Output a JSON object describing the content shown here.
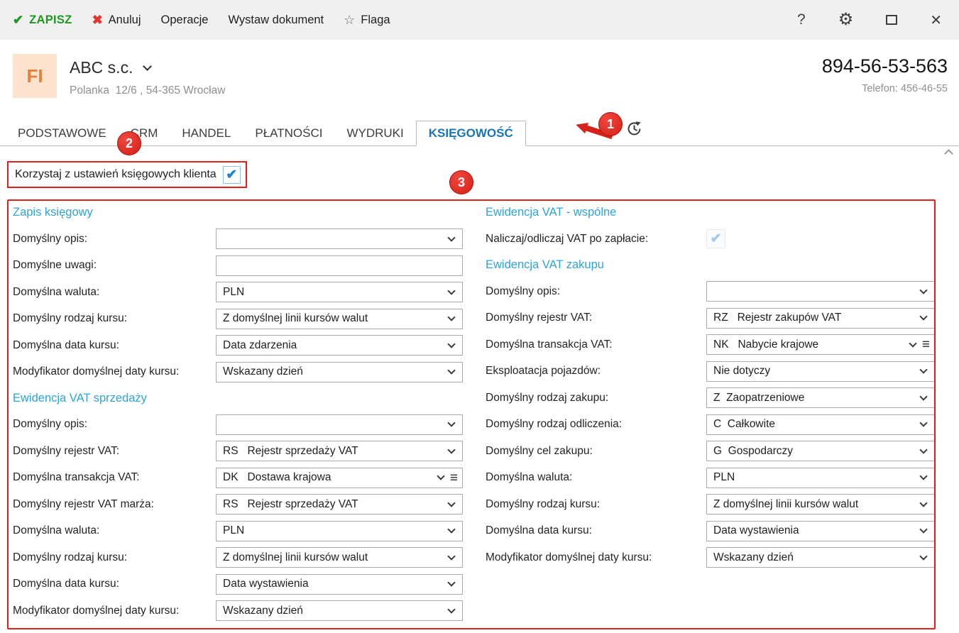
{
  "toolbar": {
    "save": "ZAPISZ",
    "cancel": "Anuluj",
    "operations": "Operacje",
    "issue_document": "Wystaw dokument",
    "flag": "Flaga",
    "help": "?"
  },
  "header": {
    "avatar_initials": "FI",
    "company_name": "ABC s.c.",
    "address": "Polanka  12/6 , 54-365 Wrocław",
    "tax_id": "894-56-53-563",
    "phone": "Telefon: 456-46-55"
  },
  "tabs": [
    {
      "label": "PODSTAWOWE",
      "active": false
    },
    {
      "label": "CRM",
      "active": false
    },
    {
      "label": "HANDEL",
      "active": false
    },
    {
      "label": "PŁATNOŚCI",
      "active": false
    },
    {
      "label": "WYDRUKI",
      "active": false
    },
    {
      "label": "KSIĘGOWOŚĆ",
      "active": true
    }
  ],
  "annotations": {
    "step1": "1",
    "step2": "2",
    "step3": "3",
    "accent_red": "#dd201d"
  },
  "settings_checkbox": {
    "label": "Korzystaj z ustawień księgowych klienta",
    "checked": true
  },
  "form": {
    "left_sections": [
      {
        "title": "Zapis księgowy",
        "fields": [
          {
            "label": "Domyślny opis:",
            "value": "",
            "type": "select"
          },
          {
            "label": "Domyślne uwagi:",
            "value": "",
            "type": "text"
          },
          {
            "label": "Domyślna waluta:",
            "value": "PLN",
            "type": "select"
          },
          {
            "label": "Domyślny rodzaj kursu:",
            "value": "Z domyślnej linii kursów walut",
            "type": "select"
          },
          {
            "label": "Domyślna data kursu:",
            "value": "Data zdarzenia",
            "type": "select"
          },
          {
            "label": "Modyfikator domyślnej daty kursu:",
            "value": "Wskazany dzień",
            "type": "select"
          }
        ]
      },
      {
        "title": "Ewidencja VAT sprzedaży",
        "fields": [
          {
            "label": "Domyślny opis:",
            "value": "",
            "type": "select"
          },
          {
            "label": "Domyślny rejestr VAT:",
            "value": "RS   Rejestr sprzedaży VAT",
            "type": "select"
          },
          {
            "label": "Domyślna transakcja VAT:",
            "value": "DK   Dostawa krajowa",
            "type": "select-menu"
          },
          {
            "label": "Domyślny rejestr VAT marża:",
            "value": "RS   Rejestr sprzedaży VAT",
            "type": "select"
          },
          {
            "label": "Domyślna waluta:",
            "value": "PLN",
            "type": "select"
          },
          {
            "label": "Domyślny rodzaj kursu:",
            "value": "Z domyślnej linii kursów walut",
            "type": "select"
          },
          {
            "label": "Domyślna data kursu:",
            "value": "Data wystawienia",
            "type": "select"
          },
          {
            "label": "Modyfikator domyślnej daty kursu:",
            "value": "Wskazany dzień",
            "type": "select"
          }
        ]
      }
    ],
    "right_sections": [
      {
        "title": "Ewidencja VAT - wspólne",
        "fields": [
          {
            "label": "Naliczaj/odliczaj VAT po zapłacie:",
            "type": "checkbox",
            "checked": true
          }
        ]
      },
      {
        "title": "Ewidencja VAT zakupu",
        "fields": [
          {
            "label": "Domyślny opis:",
            "value": "",
            "type": "select"
          },
          {
            "label": "Domyślny rejestr VAT:",
            "value": "RZ   Rejestr zakupów VAT",
            "type": "select"
          },
          {
            "label": "Domyślna transakcja VAT:",
            "value": "NK   Nabycie krajowe",
            "type": "select-menu"
          },
          {
            "label": "Eksploatacja pojazdów:",
            "value": "Nie dotyczy",
            "type": "select"
          },
          {
            "label": "Domyślny rodzaj zakupu:",
            "value": "Z  Zaopatrzeniowe",
            "type": "select"
          },
          {
            "label": "Domyślny rodzaj odliczenia:",
            "value": "C  Całkowite",
            "type": "select"
          },
          {
            "label": "Domyślny cel zakupu:",
            "value": "G  Gospodarczy",
            "type": "select"
          },
          {
            "label": "Domyślna waluta:",
            "value": "PLN",
            "type": "select"
          },
          {
            "label": "Domyślny rodzaj kursu:",
            "value": "Z domyślnej linii kursów walut",
            "type": "select"
          },
          {
            "label": "Domyślna data kursu:",
            "value": "Data wystawienia",
            "type": "select"
          },
          {
            "label": "Modyfikator domyślnej daty kursu:",
            "value": "Wskazany dzień",
            "type": "select"
          }
        ]
      }
    ]
  }
}
